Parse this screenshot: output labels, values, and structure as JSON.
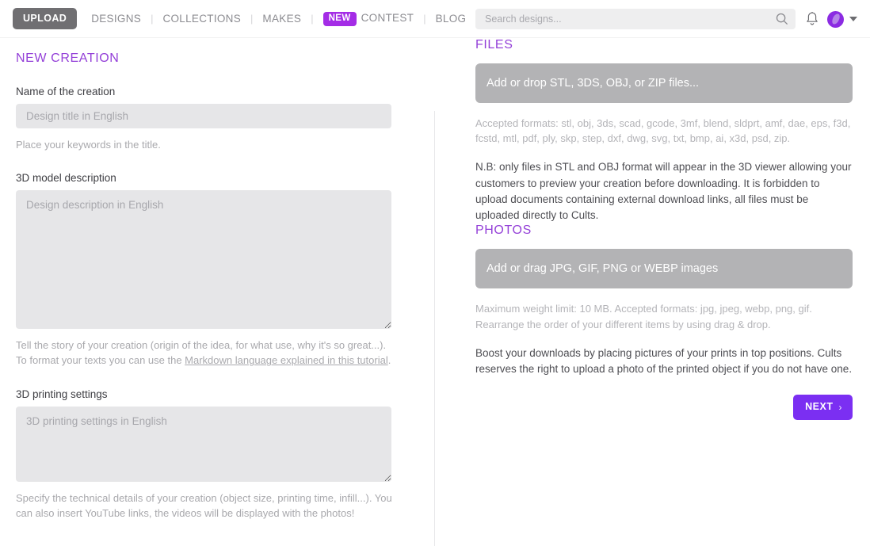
{
  "header": {
    "upload_label": "UPLOAD",
    "nav": [
      {
        "label": "DESIGNS"
      },
      {
        "label": "COLLECTIONS"
      },
      {
        "label": "MAKES"
      },
      {
        "label": "CONTEST",
        "badge": "NEW"
      },
      {
        "label": "BLOG"
      }
    ],
    "separator": "|",
    "search": {
      "placeholder": "Search designs...",
      "value": ""
    },
    "icons": {
      "search": "search-icon",
      "bell": "bell-icon",
      "avatar": "avatar",
      "caret": "chevron-down-icon"
    }
  },
  "left": {
    "page_title": "NEW CREATION",
    "name_label": "Name of the creation",
    "name_placeholder": "Design title in English",
    "name_value": "",
    "name_hint": "Place your keywords in the title.",
    "description_label": "3D model description",
    "description_placeholder": "Design description in English",
    "description_value": "",
    "description_hint_before": "Tell the story of your creation (origin of the idea, for what use, why it's so great...). To format your texts you can use the ",
    "description_hint_link": "Markdown language explained in this tutorial",
    "description_hint_after": ".",
    "printing_label": "3D printing settings",
    "printing_placeholder": "3D printing settings in English",
    "printing_value": "",
    "printing_hint": "Specify the technical details of your creation (object size, printing time, infill...). You can also insert YouTube links, the videos will be displayed with the photos!"
  },
  "right": {
    "files_title": "FILES",
    "files_dropzone": "Add or drop STL, 3DS, OBJ, or ZIP files...",
    "files_formats": "Accepted formats: stl, obj, 3ds, scad, gcode, 3mf, blend, sldprt, amf, dae, eps, f3d, fcstd, mtl, pdf, ply, skp, step, dxf, dwg, svg, txt, bmp, ai, x3d, psd, zip.",
    "files_note": "N.B: only files in STL and OBJ format will appear in the 3D viewer allowing your customers to preview your creation before downloading. It is forbidden to upload documents containing external download links, all files must be uploaded directly to Cults.",
    "photos_title": "PHOTOS",
    "photos_dropzone": "Add or drag JPG, GIF, PNG or WEBP images",
    "photos_formats": "Maximum weight limit: 10 MB. Accepted formats: jpg, jpeg, webp, png, gif. Rearrange the order of your different items by using drag & drop.",
    "photos_note": "Boost your downloads by placing pictures of your prints in top positions. Cults reserves the right to upload a photo of the printed object if you do not have one.",
    "next_label": "NEXT",
    "next_chevron": "›"
  },
  "colors": {
    "accent_purple": "#9440d8",
    "button_purple": "#7b2ff2",
    "badge_purple": "#a42ce6",
    "upload_gray": "#706f72",
    "dropzone_gray": "#b3b3b5",
    "field_gray": "#e6e6e8"
  }
}
